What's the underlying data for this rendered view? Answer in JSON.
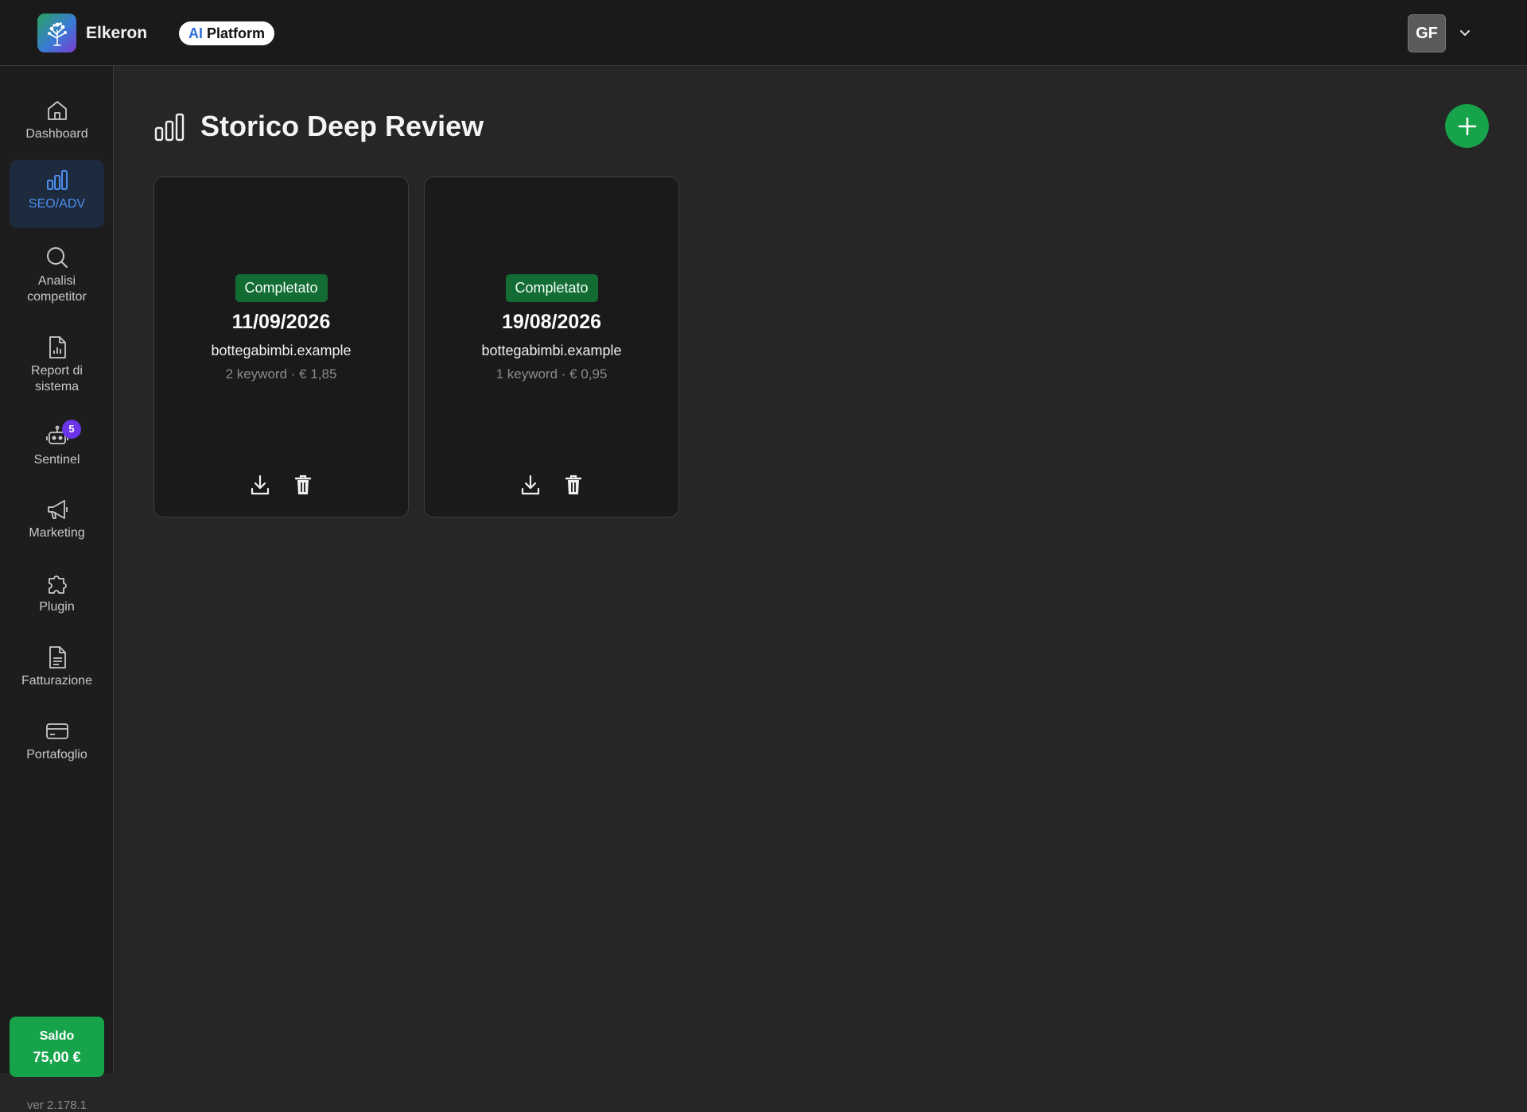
{
  "header": {
    "brand": "Elkeron",
    "pill_ai": "AI",
    "pill_label": "Platform",
    "avatar_initials": "GF"
  },
  "sidebar": {
    "items": [
      {
        "label": "Dashboard",
        "icon": "home-icon",
        "active": false
      },
      {
        "label": "SEO/ADV",
        "icon": "bar-chart-icon",
        "active": true
      },
      {
        "label": "Analisi competitor",
        "icon": "search-icon",
        "active": false
      },
      {
        "label": "Report di sistema",
        "icon": "report-file-icon",
        "active": false
      },
      {
        "label": "Sentinel",
        "icon": "robot-icon",
        "active": false,
        "badge": "5"
      },
      {
        "label": "Marketing",
        "icon": "megaphone-icon",
        "active": false
      },
      {
        "label": "Plugin",
        "icon": "puzzle-icon",
        "active": false
      },
      {
        "label": "Fatturazione",
        "icon": "invoice-file-icon",
        "active": false
      },
      {
        "label": "Portafoglio",
        "icon": "credit-card-icon",
        "active": false
      }
    ],
    "saldo_label": "Saldo",
    "saldo_amount": "75,00 €",
    "version": "ver 2.178.1"
  },
  "main": {
    "title": "Storico Deep Review",
    "cards": [
      {
        "status": "Completato",
        "date": "11/09/2026",
        "domain": "bottegabimbi.example",
        "meta": "2 keyword · € 1,85"
      },
      {
        "status": "Completato",
        "date": "19/08/2026",
        "domain": "bottegabimbi.example",
        "meta": "1 keyword · € 0,95"
      }
    ]
  },
  "colors": {
    "accent_green": "#16a34a",
    "active_blue": "#4d8ff0",
    "badge_purple": "#6a35e8"
  }
}
